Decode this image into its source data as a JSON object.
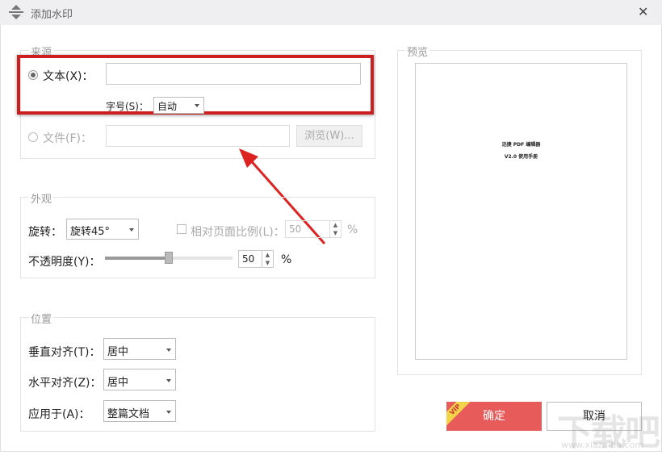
{
  "window": {
    "title": "添加水印",
    "close": "✕"
  },
  "source": {
    "legend": "来源",
    "text_label": "文本(X)：",
    "text_value": "",
    "size_label": "字号(S)：",
    "size_value": "自动",
    "file_label": "文件(F)：",
    "file_value": "",
    "browse": "浏览(W)..."
  },
  "appearance": {
    "legend": "外观",
    "rotate_label": "旋转：",
    "rotate_value": "旋转45°",
    "relative_label": "相对页面比例(L)：",
    "relative_value": "50",
    "relative_unit": "%",
    "opacity_label": "不透明度(Y)：",
    "opacity_value": "50",
    "opacity_unit": "%",
    "opacity_fraction": 0.5
  },
  "position": {
    "legend": "位置",
    "vertical_label": "垂直对齐(T)：",
    "vertical_value": "居中",
    "horizontal_label": "水平对齐(Z)：",
    "horizontal_value": "居中",
    "apply_label": "应用于(A)：",
    "apply_value": "整篇文档"
  },
  "preview": {
    "legend": "预览",
    "line1": "迅捷 PDF 编辑器",
    "line2": "V2.0 使用手册"
  },
  "buttons": {
    "ok": "确定",
    "cancel": "取消",
    "vip": "VIP"
  },
  "watermark": {
    "text": "下载吧",
    "url": "www.xiazaiba.com"
  },
  "colors": {
    "highlight": "#cc1f1f",
    "ok": "#e85b5b",
    "vip": "#f2d44a"
  }
}
